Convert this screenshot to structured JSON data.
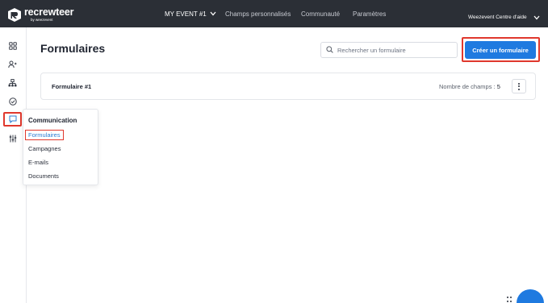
{
  "header": {
    "logo_name": "recrewteer",
    "logo_sub": "by weezevent",
    "event_label": "MY EVENT #1",
    "nav": [
      "Champs personnalisés",
      "Communauté",
      "Paramètres"
    ],
    "help_label": "Weezevent Centre d'aide"
  },
  "sidebar": {
    "icons": [
      "apps-icon",
      "people-icon",
      "org-chart-icon",
      "check-circle-icon",
      "chat-icon",
      "sliders-icon"
    ],
    "active": "chat-icon"
  },
  "flyout": {
    "title": "Communication",
    "items": [
      "Formulaires",
      "Campagnes",
      "E-mails",
      "Documents"
    ],
    "selected": "Formulaires"
  },
  "main": {
    "title": "Formulaires",
    "search_placeholder": "Rechercher un formulaire",
    "create_button": "Créer un formulaire",
    "forms": [
      {
        "name": "Formulaire #1",
        "count_label": "Nombre de champs :",
        "count": "5"
      }
    ]
  },
  "colors": {
    "topbar": "#2b2f36",
    "accent": "#1f7ae0",
    "highlight": "#e0382d"
  }
}
